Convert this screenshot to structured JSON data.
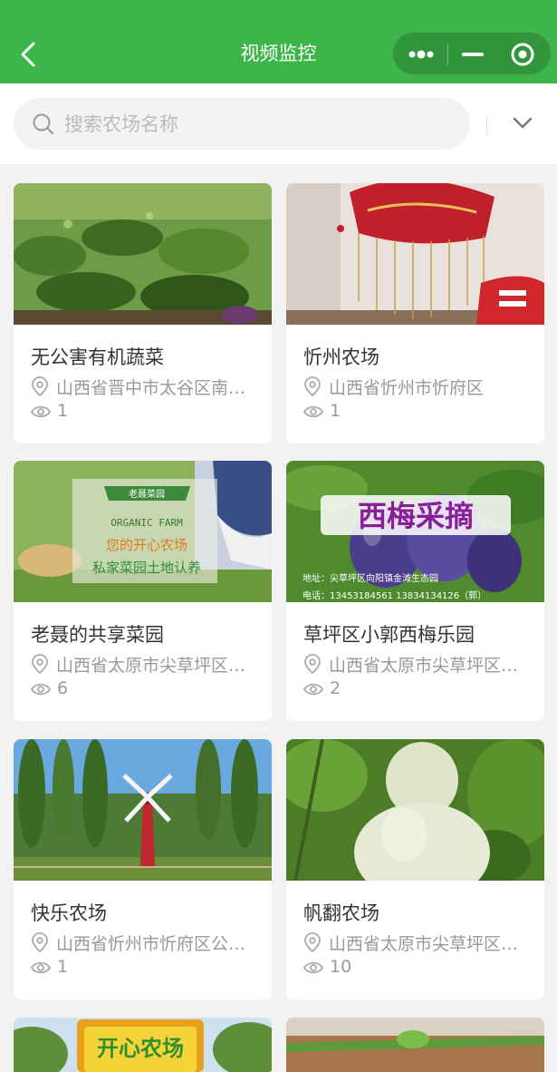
{
  "header": {
    "title": "视频监控"
  },
  "search": {
    "placeholder": "搜索农场名称",
    "value": ""
  },
  "farms": [
    {
      "name": "无公害有机蔬菜",
      "address": "山西省晋中市太谷区南…",
      "views": "1"
    },
    {
      "name": "忻州农场",
      "address": "山西省忻州市忻府区",
      "views": "1"
    },
    {
      "name": "老聂的共享菜园",
      "address": "山西省太原市尖草坪区…",
      "views": "6",
      "image_text": {
        "banner": "老聂菜园",
        "line1": "ORGANIC FARM",
        "line2": "您的开心农场",
        "line3": "私家菜园土地认养"
      }
    },
    {
      "name": "草坪区小郭西梅乐园",
      "address": "山西省太原市尖草坪区…",
      "views": "2",
      "image_text": {
        "title": "西梅采摘",
        "addr": "地址：尖草坪区向阳镇金滩生态园",
        "phone": "电话：13453184561 13834134126（郭）"
      }
    },
    {
      "name": "快乐农场",
      "address": "山西省忻州市忻府区公…",
      "views": "1"
    },
    {
      "name": "帆翻农场",
      "address": "山西省太原市尖草坪区…",
      "views": "10"
    }
  ],
  "partial_cards": [
    {
      "image_text": "开心农场"
    },
    {
      "image_text": ""
    }
  ],
  "icons": {
    "back": "back-arrow-icon",
    "more": "more-dots-icon",
    "minimize": "minimize-icon",
    "close": "close-target-icon",
    "search": "search-icon",
    "dropdown": "chevron-down-icon",
    "location": "location-pin-icon",
    "views": "eye-icon"
  },
  "colors": {
    "header": "#3cb64a",
    "text_primary": "#333333",
    "text_secondary": "#999999"
  }
}
